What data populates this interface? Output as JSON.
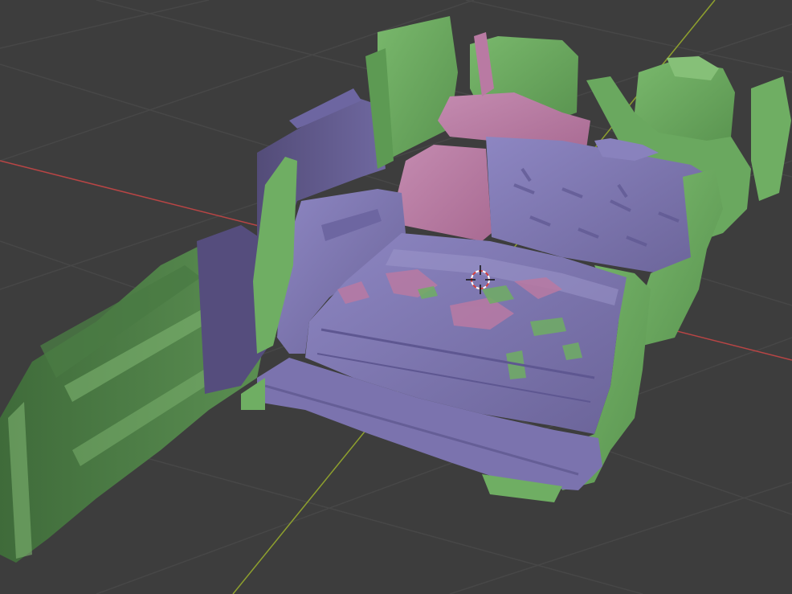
{
  "viewport": {
    "background_color": "#3d3d3d",
    "grid_color": "#4a4a4a",
    "x_axis_color": "#c04a4a",
    "y_axis_color": "#8aa030",
    "cursor_icon": "3d-cursor-icon"
  },
  "mesh": {
    "segment_colors": {
      "green": "#6fae63",
      "purple": "#7c74b0",
      "pink": "#b97aa3"
    }
  }
}
